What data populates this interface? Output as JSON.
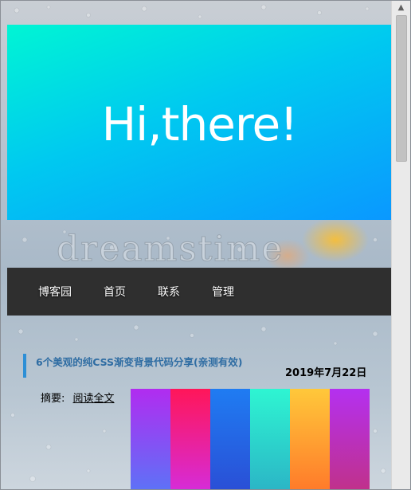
{
  "hero": {
    "title": "Hi,there!"
  },
  "watermark": {
    "text": "dreamstime"
  },
  "nav": {
    "items": [
      {
        "label": "博客园"
      },
      {
        "label": "首页"
      },
      {
        "label": "联系"
      },
      {
        "label": "管理"
      }
    ]
  },
  "post": {
    "title": "6个美观的纯CSS渐变背景代码分享(亲测有效)",
    "date": "2019年7月22日",
    "summary_label": "摘要:",
    "read_more": "阅读全文",
    "thumbnail_colors": [
      [
        "#b12cf0",
        "#5d72f7"
      ],
      [
        "#ff1659",
        "#d62cd8"
      ],
      [
        "#1f7cf2",
        "#2a4fd6"
      ],
      [
        "#2ef5d2",
        "#2bb5c6"
      ],
      [
        "#ffc83a",
        "#ff7a2a"
      ],
      [
        "#b430f0",
        "#c0318a"
      ]
    ]
  },
  "colors": {
    "nav_bg": "#2f2f2f",
    "title_accent": "#2d8fd6",
    "title_text": "#2f6da3"
  }
}
